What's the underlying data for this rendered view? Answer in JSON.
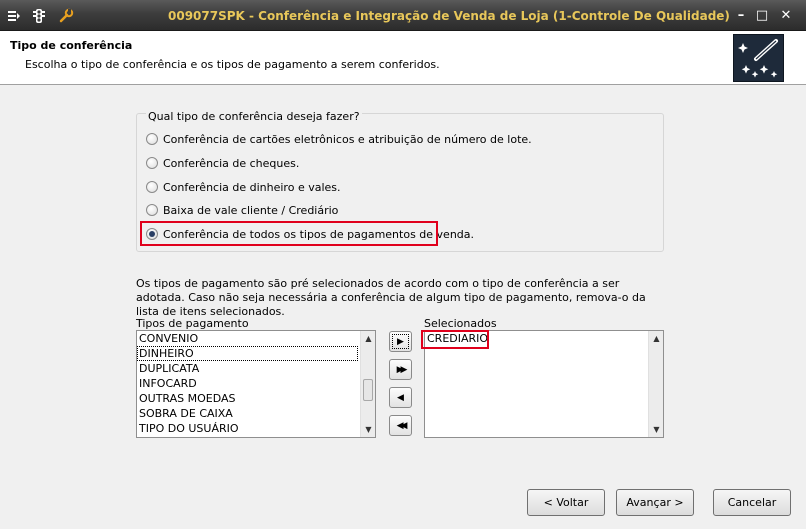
{
  "window": {
    "title": "009077SPK - Conferência e Integração de Venda de Loja (1-Controle De Qualidade)",
    "minimize": "–",
    "maximize": "□",
    "close": "✕"
  },
  "header": {
    "title": "Tipo de conferência",
    "subtitle": "Escolha o tipo de conferência e os tipos de pagamento a serem conferidos."
  },
  "conference_group": {
    "title": "Qual tipo de conferência deseja fazer?",
    "options": [
      {
        "label": "Conferência de cartões eletrônicos e atribuição de número de lote.",
        "checked": false
      },
      {
        "label": "Conferência de cheques.",
        "checked": false
      },
      {
        "label": "Conferência de dinheiro e vales.",
        "checked": false
      },
      {
        "label": "Baixa de vale cliente / Crediário",
        "checked": false
      },
      {
        "label": "Conferência de todos os tipos de pagamentos de venda.",
        "checked": true
      }
    ]
  },
  "info_text": "Os tipos de pagamento são pré selecionados de acordo com o tipo de conferência a ser adotada. Caso não seja necessária a conferência de algum tipo de pagamento, remova-o da lista de itens selecionados.",
  "payment_types": {
    "label": "Tipos de pagamento",
    "items": [
      "CONVENIO",
      "DINHEIRO",
      "DUPLICATA",
      "INFOCARD",
      "OUTRAS MOEDAS",
      "SOBRA DE CAIXA",
      "TIPO DO USUÁRIO"
    ],
    "focused_index": 1
  },
  "selected": {
    "label": "Selecionados",
    "items": [
      "CREDIARIO"
    ]
  },
  "move_buttons": {
    "add": "▶",
    "add_all": "▶▶",
    "remove": "◀",
    "remove_all": "◀◀"
  },
  "footer": {
    "back": "< Voltar",
    "next": "Avançar >",
    "cancel": "Cancelar"
  },
  "colors": {
    "title_text": "#e8c75a",
    "highlight": "#e0001c"
  }
}
